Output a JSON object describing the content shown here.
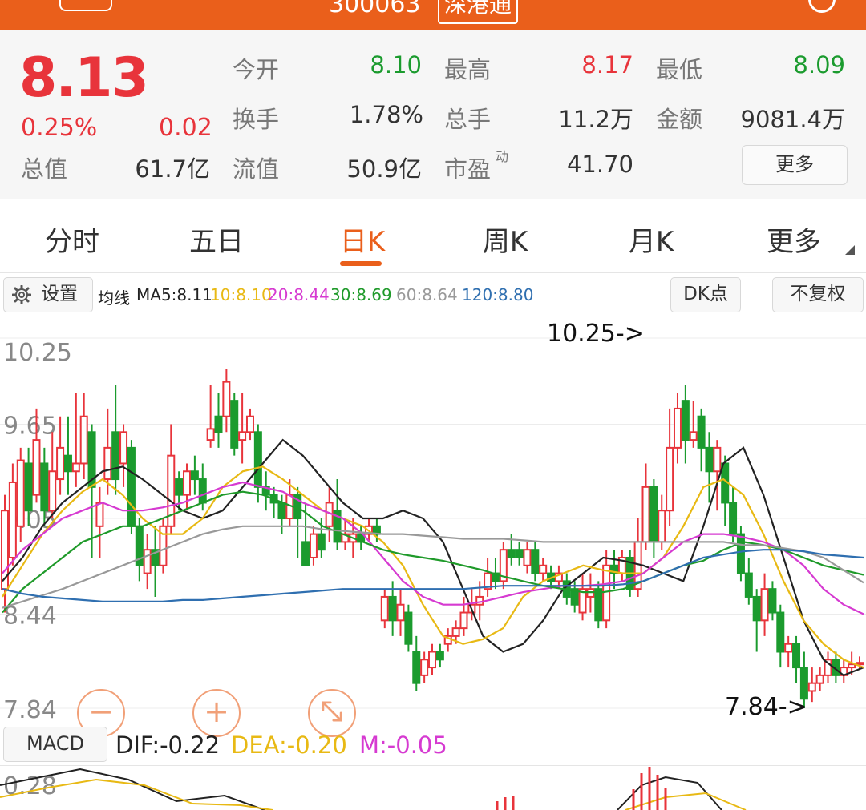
{
  "header": {
    "stock_code": "300063",
    "connect_tag": "深港通"
  },
  "quote": {
    "price": "8.13",
    "change_pct": "0.25%",
    "change": "0.02",
    "fields": {
      "open_label": "今开",
      "open": "8.10",
      "high_label": "最高",
      "high": "8.17",
      "low_label": "最低",
      "low": "8.09",
      "turnover_label": "换手",
      "turnover": "1.78%",
      "volume_label": "总手",
      "volume": "11.2万",
      "amount_label": "金额",
      "amount": "9081.4万",
      "total_mv_label": "总值",
      "total_mv": "61.7亿",
      "float_mv_label": "流值",
      "float_mv": "50.9亿",
      "pe_label": "市盈",
      "pe_sup": "动",
      "pe": "41.70"
    },
    "more_label": "更多"
  },
  "tabs": [
    "分时",
    "五日",
    "日K",
    "周K",
    "月K",
    "更多"
  ],
  "active_tab": "日K",
  "toolbar": {
    "settings_label": "设置",
    "ma_title": "均线",
    "ma": [
      {
        "label": "MA5:8.11",
        "color": "#222222"
      },
      {
        "label": "10:8.10",
        "color": "#e8b914"
      },
      {
        "label": "20:8.44",
        "color": "#d63ad1"
      },
      {
        "label": "30:8.69",
        "color": "#1f9a2a"
      },
      {
        "label": "60:8.64",
        "color": "#999999"
      },
      {
        "label": "120:8.80",
        "color": "#2f6fb0"
      }
    ],
    "dk_label": "DK点",
    "fq_label": "不复权"
  },
  "colors": {
    "up": "#e8343b",
    "down": "#1b9b2e",
    "accent": "#ea5f1b"
  },
  "chart_data": {
    "type": "candlestick",
    "y_ticks": [
      "10.25",
      "9.65",
      "9.05",
      "8.44",
      "7.84"
    ],
    "ylim": [
      7.84,
      10.25
    ],
    "annotations": [
      {
        "text": "10.25->"
      },
      {
        "text": "7.84->"
      }
    ],
    "candles": [
      [
        8.6,
        9.1,
        8.45,
        9.2
      ],
      [
        8.8,
        9.28,
        8.75,
        9.4
      ],
      [
        9.0,
        9.42,
        8.9,
        9.5
      ],
      [
        9.4,
        9.1,
        9.0,
        9.5
      ],
      [
        9.2,
        9.55,
        9.15,
        9.75
      ],
      [
        9.4,
        9.1,
        9.0,
        9.5
      ],
      [
        9.1,
        9.35,
        9.05,
        9.6
      ],
      [
        9.3,
        9.5,
        9.2,
        9.7
      ],
      [
        9.45,
        9.35,
        9.2,
        9.7
      ],
      [
        9.35,
        9.4,
        9.25,
        9.85
      ],
      [
        9.4,
        9.7,
        9.3,
        9.85
      ],
      [
        9.6,
        9.25,
        8.8,
        9.65
      ],
      [
        9.0,
        9.15,
        8.8,
        9.25
      ],
      [
        9.3,
        9.5,
        9.2,
        9.75
      ],
      [
        9.6,
        9.3,
        9.2,
        9.9
      ],
      [
        9.4,
        9.6,
        9.25,
        9.65
      ],
      [
        9.5,
        9.0,
        8.95,
        9.55
      ],
      [
        9.0,
        8.75,
        8.65,
        9.05
      ],
      [
        8.7,
        8.85,
        8.6,
        8.95
      ],
      [
        8.85,
        8.75,
        8.55,
        9.0
      ],
      [
        8.75,
        9.0,
        8.7,
        9.05
      ],
      [
        9.0,
        9.45,
        8.95,
        9.65
      ],
      [
        9.3,
        9.2,
        9.1,
        9.35
      ],
      [
        9.2,
        9.35,
        9.1,
        9.4
      ],
      [
        9.35,
        9.3,
        9.2,
        9.45
      ],
      [
        9.3,
        9.15,
        9.1,
        9.4
      ],
      [
        9.55,
        9.62,
        9.5,
        9.9
      ],
      [
        9.7,
        9.6,
        9.5,
        9.85
      ],
      [
        9.7,
        9.92,
        9.6,
        10.0
      ],
      [
        9.8,
        9.5,
        9.45,
        9.85
      ],
      [
        9.55,
        9.6,
        9.4,
        9.85
      ],
      [
        9.6,
        9.7,
        9.55,
        9.75
      ],
      [
        9.6,
        9.25,
        9.15,
        9.65
      ],
      [
        9.25,
        9.2,
        9.1,
        9.35
      ],
      [
        9.2,
        9.15,
        9.05,
        9.25
      ],
      [
        9.15,
        9.05,
        8.95,
        9.2
      ],
      [
        9.05,
        9.2,
        9.0,
        9.3
      ],
      [
        9.2,
        9.05,
        8.8,
        9.25
      ],
      [
        8.9,
        8.75,
        8.75,
        9.15
      ],
      [
        8.8,
        8.95,
        8.75,
        9.0
      ],
      [
        8.95,
        8.85,
        8.8,
        9.05
      ],
      [
        9.0,
        9.15,
        8.9,
        9.25
      ],
      [
        9.1,
        8.9,
        8.85,
        9.3
      ],
      [
        8.9,
        8.95,
        8.85,
        9.05
      ],
      [
        8.9,
        8.95,
        8.8,
        9.05
      ],
      [
        8.95,
        8.9,
        8.85,
        9.0
      ],
      [
        8.95,
        9.0,
        8.9,
        9.05
      ],
      [
        9.0,
        8.95,
        8.9,
        9.05
      ],
      [
        8.4,
        8.55,
        8.35,
        8.6
      ],
      [
        8.55,
        8.4,
        8.3,
        8.65
      ],
      [
        8.4,
        8.5,
        8.3,
        8.6
      ],
      [
        8.45,
        8.25,
        8.2,
        8.5
      ],
      [
        8.2,
        8.0,
        7.95,
        8.3
      ],
      [
        8.05,
        8.15,
        8.0,
        8.2
      ],
      [
        8.1,
        8.2,
        8.05,
        8.25
      ],
      [
        8.2,
        8.15,
        8.1,
        8.25
      ],
      [
        8.25,
        8.3,
        8.2,
        8.35
      ],
      [
        8.3,
        8.35,
        8.25,
        8.4
      ],
      [
        8.35,
        8.45,
        8.3,
        8.55
      ],
      [
        8.45,
        8.5,
        8.4,
        8.6
      ],
      [
        8.5,
        8.55,
        8.4,
        8.65
      ],
      [
        8.6,
        8.7,
        8.55,
        8.8
      ],
      [
        8.7,
        8.65,
        8.6,
        8.8
      ],
      [
        8.65,
        8.85,
        8.6,
        8.9
      ],
      [
        8.85,
        8.8,
        8.75,
        8.95
      ],
      [
        8.85,
        8.8,
        8.75,
        8.9
      ],
      [
        8.75,
        8.85,
        8.7,
        8.9
      ],
      [
        8.85,
        8.7,
        8.65,
        8.9
      ],
      [
        8.7,
        8.75,
        8.65,
        8.8
      ],
      [
        8.7,
        8.65,
        8.6,
        8.75
      ],
      [
        8.65,
        8.7,
        8.6,
        8.75
      ],
      [
        8.65,
        8.55,
        8.5,
        8.7
      ],
      [
        8.6,
        8.5,
        8.45,
        8.65
      ],
      [
        8.45,
        8.6,
        8.4,
        8.7
      ],
      [
        8.55,
        8.6,
        8.45,
        8.7
      ],
      [
        8.6,
        8.4,
        8.35,
        8.65
      ],
      [
        8.4,
        8.75,
        8.35,
        8.85
      ],
      [
        8.75,
        8.7,
        8.6,
        8.85
      ],
      [
        8.7,
        8.8,
        8.65,
        8.85
      ],
      [
        8.8,
        8.6,
        8.55,
        8.85
      ],
      [
        8.6,
        8.9,
        8.55,
        9.05
      ],
      [
        8.9,
        9.25,
        8.85,
        9.4
      ],
      [
        9.25,
        8.9,
        8.8,
        9.3
      ],
      [
        8.9,
        9.1,
        8.85,
        9.2
      ],
      [
        9.1,
        9.5,
        9.0,
        9.75
      ],
      [
        9.5,
        9.75,
        9.4,
        9.85
      ],
      [
        9.8,
        9.55,
        9.4,
        9.9
      ],
      [
        9.55,
        9.6,
        9.5,
        9.8
      ],
      [
        9.7,
        9.5,
        9.35,
        9.75
      ],
      [
        9.5,
        9.35,
        9.15,
        9.6
      ],
      [
        9.35,
        9.5,
        9.1,
        9.55
      ],
      [
        9.4,
        9.15,
        9.0,
        9.45
      ],
      [
        9.15,
        8.95,
        8.9,
        9.25
      ],
      [
        8.95,
        8.7,
        8.65,
        9.0
      ],
      [
        8.7,
        8.55,
        8.5,
        8.8
      ],
      [
        8.55,
        8.4,
        8.2,
        8.6
      ],
      [
        8.4,
        8.6,
        8.3,
        8.7
      ],
      [
        8.6,
        8.45,
        8.4,
        8.65
      ],
      [
        8.45,
        8.2,
        8.1,
        8.5
      ],
      [
        8.2,
        8.25,
        8.1,
        8.3
      ],
      [
        8.25,
        8.1,
        8.0,
        8.3
      ],
      [
        8.1,
        7.9,
        7.84,
        8.2
      ],
      [
        7.95,
        8.0,
        7.88,
        8.1
      ],
      [
        8.0,
        8.05,
        7.95,
        8.1
      ],
      [
        8.05,
        8.15,
        8.0,
        8.2
      ],
      [
        8.15,
        8.05,
        8.0,
        8.2
      ],
      [
        8.05,
        8.1,
        8.0,
        8.15
      ],
      [
        8.1,
        8.12,
        8.05,
        8.2
      ],
      [
        8.12,
        8.13,
        8.09,
        8.17
      ]
    ],
    "ma_lines": [
      {
        "name": "MA5",
        "color": "#222222",
        "values": [
          8.65,
          8.8,
          9.0,
          9.15,
          9.25,
          9.35,
          9.38,
          9.3,
          9.2,
          9.1,
          9.05,
          9.1,
          9.25,
          9.4,
          9.55,
          9.45,
          9.3,
          9.15,
          9.05,
          9.05,
          9.1,
          9.05,
          8.9,
          8.6,
          8.3,
          8.2,
          8.25,
          8.4,
          8.6,
          8.7,
          8.8,
          8.78,
          8.75,
          8.7,
          8.65,
          9.0,
          9.4,
          9.5,
          9.2,
          8.8,
          8.4,
          8.15,
          8.05,
          8.1
        ]
      },
      {
        "name": "MA10",
        "color": "#e8b914",
        "values": [
          8.55,
          8.75,
          8.95,
          9.1,
          9.22,
          9.3,
          9.2,
          9.05,
          8.95,
          8.95,
          9.05,
          9.25,
          9.35,
          9.38,
          9.3,
          9.2,
          9.1,
          9.05,
          9.0,
          8.9,
          8.75,
          8.5,
          8.3,
          8.25,
          8.28,
          8.35,
          8.55,
          8.65,
          8.7,
          8.75,
          8.72,
          8.7,
          8.7,
          8.8,
          9.0,
          9.25,
          9.3,
          9.2,
          8.95,
          8.65,
          8.4,
          8.25,
          8.15,
          8.1
        ]
      },
      {
        "name": "MA20",
        "color": "#d63ad1",
        "values": [
          8.7,
          8.85,
          8.95,
          9.05,
          9.1,
          9.15,
          9.1,
          9.1,
          9.12,
          9.15,
          9.2,
          9.25,
          9.28,
          9.25,
          9.22,
          9.15,
          9.1,
          9.05,
          8.95,
          8.8,
          8.65,
          8.55,
          8.5,
          8.5,
          8.52,
          8.55,
          8.58,
          8.6,
          8.62,
          8.62,
          8.63,
          8.65,
          8.7,
          8.8,
          8.9,
          8.95,
          8.95,
          8.93,
          8.9,
          8.85,
          8.75,
          8.6,
          8.5,
          8.44
        ]
      },
      {
        "name": "MA30",
        "color": "#1f9a2a",
        "values": [
          8.45,
          8.6,
          8.7,
          8.8,
          8.9,
          8.95,
          9.0,
          9.0,
          9.05,
          9.1,
          9.15,
          9.2,
          9.22,
          9.2,
          9.15,
          9.1,
          9.0,
          8.95,
          8.9,
          8.85,
          8.82,
          8.8,
          8.78,
          8.75,
          8.72,
          8.68,
          8.65,
          8.62,
          8.6,
          8.58,
          8.58,
          8.6,
          8.65,
          8.7,
          8.75,
          8.78,
          8.85,
          8.9,
          8.88,
          8.85,
          8.8,
          8.75,
          8.72,
          8.69
        ]
      },
      {
        "name": "MA60",
        "color": "#999999",
        "values": [
          8.48,
          8.52,
          8.56,
          8.6,
          8.65,
          8.7,
          8.75,
          8.8,
          8.85,
          8.9,
          8.95,
          8.98,
          9.0,
          9.0,
          9.0,
          9.0,
          8.98,
          8.97,
          8.96,
          8.95,
          8.95,
          8.94,
          8.93,
          8.92,
          8.92,
          8.92,
          8.91,
          8.9,
          8.9,
          8.9,
          8.9,
          8.9,
          8.9,
          8.9,
          8.9,
          8.9,
          8.9,
          8.88,
          8.88,
          8.86,
          8.84,
          8.8,
          8.72,
          8.64
        ]
      },
      {
        "name": "MA120",
        "color": "#2f6fb0",
        "values": [
          8.6,
          8.57,
          8.55,
          8.54,
          8.53,
          8.52,
          8.52,
          8.52,
          8.52,
          8.53,
          8.53,
          8.54,
          8.55,
          8.56,
          8.57,
          8.58,
          8.59,
          8.6,
          8.6,
          8.6,
          8.6,
          8.6,
          8.6,
          8.6,
          8.61,
          8.62,
          8.62,
          8.62,
          8.62,
          8.62,
          8.62,
          8.63,
          8.65,
          8.7,
          8.75,
          8.8,
          8.82,
          8.84,
          8.85,
          8.85,
          8.84,
          8.82,
          8.81,
          8.8
        ]
      }
    ]
  },
  "macd": {
    "button_label": "MACD",
    "dif": "DIF:-0.22",
    "dea": "DEA:-0.20",
    "m": "M:-0.05",
    "top_tick": "0.28"
  }
}
